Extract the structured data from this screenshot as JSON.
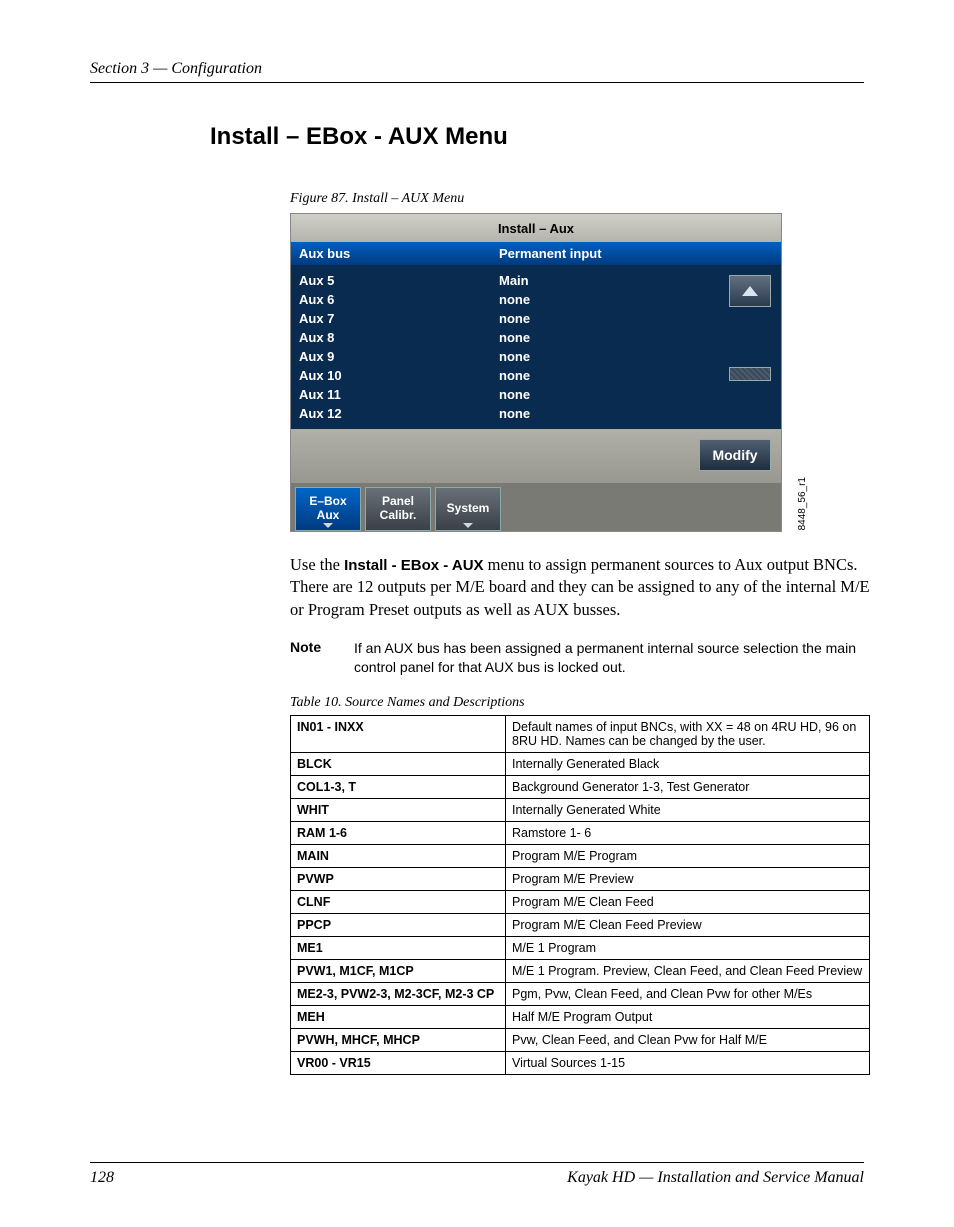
{
  "running_head": "Section 3 — Configuration",
  "title": "Install – EBox - AUX Menu",
  "figure_caption": "Figure 87.  Install – AUX Menu",
  "screenshot": {
    "window_title": "Install – Aux",
    "col1_header": "Aux bus",
    "col2_header": "Permanent input",
    "rows": [
      {
        "bus": "Aux 5",
        "input": "Main"
      },
      {
        "bus": "Aux 6",
        "input": "none"
      },
      {
        "bus": "Aux 7",
        "input": "none"
      },
      {
        "bus": "Aux 8",
        "input": "none"
      },
      {
        "bus": "Aux 9",
        "input": "none"
      },
      {
        "bus": "Aux 10",
        "input": "none"
      },
      {
        "bus": "Aux 11",
        "input": "none"
      },
      {
        "bus": "Aux 12",
        "input": "none"
      }
    ],
    "modify_label": "Modify",
    "tabs": {
      "ebox_line1": "E–Box",
      "ebox_line2": "Aux",
      "panel_line1": "Panel",
      "panel_line2": "Calibr.",
      "system": "System"
    },
    "side_code": "8448_56_r1"
  },
  "body": {
    "pre": "Use the ",
    "bold": "Install - EBox - AUX",
    "post": " menu to assign permanent sources to Aux output BNCs. There are 12 outputs per M/E board and they can be assigned to any of the internal M/E or Program Preset outputs as well as AUX busses."
  },
  "note": {
    "label": "Note",
    "text": "If an AUX bus has been assigned a permanent internal source selection the main control panel for that AUX bus is locked out."
  },
  "table_caption": "Table 10.  Source Names and Descriptions",
  "table_rows": [
    {
      "k": "IN01 - INXX",
      "v": "Default names of input BNCs, with XX = 48 on 4RU HD, 96 on 8RU HD. Names can be changed by the user."
    },
    {
      "k": "BLCK",
      "v": "Internally Generated Black"
    },
    {
      "k": "COL1-3, T",
      "v": "Background Generator 1-3, Test Generator"
    },
    {
      "k": "WHIT",
      "v": "Internally Generated White"
    },
    {
      "k": "RAM 1-6",
      "v": "Ramstore 1- 6"
    },
    {
      "k": "MAIN",
      "v": "Program M/E Program"
    },
    {
      "k": "PVWP",
      "v": "Program M/E Preview"
    },
    {
      "k": "CLNF",
      "v": "Program M/E Clean Feed"
    },
    {
      "k": "PPCP",
      "v": "Program M/E Clean Feed Preview"
    },
    {
      "k": "ME1",
      "v": "M/E 1 Program"
    },
    {
      "k": "PVW1, M1CF, M1CP",
      "v": "M/E 1 Program. Preview, Clean Feed, and Clean Feed Preview"
    },
    {
      "k": "ME2-3, PVW2-3, M2-3CF, M2-3 CP",
      "v": "Pgm, Pvw, Clean Feed, and Clean Pvw for other M/Es"
    },
    {
      "k": "MEH",
      "v": "Half M/E Program Output"
    },
    {
      "k": "PVWH, MHCF, MHCP",
      "v": "Pvw, Clean Feed, and Clean Pvw for Half M/E"
    },
    {
      "k": "VR00 - VR15",
      "v": "Virtual Sources 1-15"
    }
  ],
  "footer": {
    "page": "128",
    "title": "Kayak HD  —  Installation and Service Manual"
  }
}
